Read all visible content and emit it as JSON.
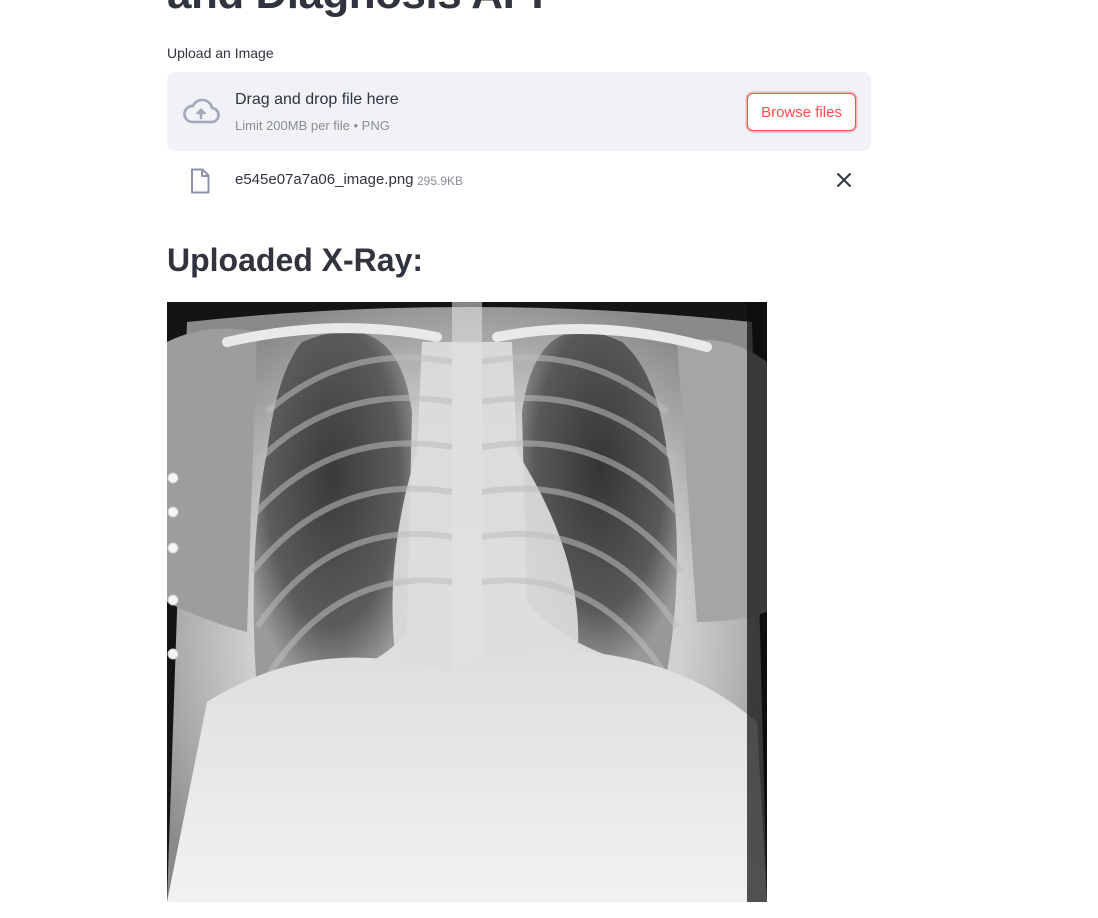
{
  "app": {
    "title": "and Diagnosis API"
  },
  "uploader": {
    "label": "Upload an Image",
    "drop_title": "Drag and drop file here",
    "limit_text": "Limit 200MB per file • PNG",
    "browse_label": "Browse files",
    "icon": "cloud-upload-icon"
  },
  "uploaded_file": {
    "name": "e545e07a7a06_image.png",
    "size": "295.9KB",
    "icon": "file-icon",
    "remove_icon": "close-icon"
  },
  "result": {
    "heading": "Uploaded X-Ray:",
    "image_description": "chest-xray"
  },
  "colors": {
    "accent": "#ff4b4b",
    "dropzone_bg": "#f0f2f6",
    "text": "#31333f",
    "muted": "#8b8d95"
  }
}
